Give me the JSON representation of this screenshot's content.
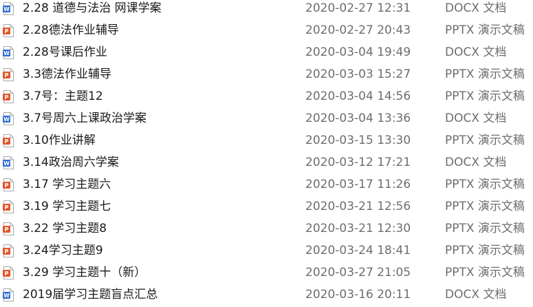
{
  "icon_colors": {
    "docx": "#2b6ad3",
    "pptx": "#e0562a"
  },
  "files": [
    {
      "name": "2.28 道德与法治 网课学案",
      "modified": "2020-02-27 12:31",
      "type": "DOCX 文档",
      "icon": "word-document-icon",
      "icon_letter": "W"
    },
    {
      "name": "2.28德法作业辅导",
      "modified": "2020-02-27 20:43",
      "type": "PPTX 演示文稿",
      "icon": "powerpoint-document-icon",
      "icon_letter": "P"
    },
    {
      "name": "2.28号课后作业",
      "modified": "2020-03-04 19:49",
      "type": "DOCX 文档",
      "icon": "word-document-icon",
      "icon_letter": "W"
    },
    {
      "name": "3.3德法作业辅导",
      "modified": "2020-03-03 15:27",
      "type": "PPTX 演示文稿",
      "icon": "powerpoint-document-icon",
      "icon_letter": "P"
    },
    {
      "name": "3.7号：主题12",
      "modified": "2020-03-04 14:56",
      "type": "PPTX 演示文稿",
      "icon": "powerpoint-document-icon",
      "icon_letter": "P"
    },
    {
      "name": "3.7号周六上课政治学案",
      "modified": "2020-03-04 13:36",
      "type": "DOCX 文档",
      "icon": "word-document-icon",
      "icon_letter": "W"
    },
    {
      "name": "3.10作业讲解",
      "modified": "2020-03-15 13:30",
      "type": "PPTX 演示文稿",
      "icon": "powerpoint-document-icon",
      "icon_letter": "P"
    },
    {
      "name": "3.14政治周六学案",
      "modified": "2020-03-12 17:21",
      "type": "DOCX 文档",
      "icon": "word-document-icon",
      "icon_letter": "W"
    },
    {
      "name": "3.17 学习主题六",
      "modified": "2020-03-17 11:26",
      "type": "PPTX 演示文稿",
      "icon": "powerpoint-document-icon",
      "icon_letter": "P"
    },
    {
      "name": "3.19 学习主题七",
      "modified": "2020-03-21 12:56",
      "type": "PPTX 演示文稿",
      "icon": "powerpoint-document-icon",
      "icon_letter": "P"
    },
    {
      "name": "3.22 学习主题8",
      "modified": "2020-03-21 12:30",
      "type": "PPTX 演示文稿",
      "icon": "powerpoint-document-icon",
      "icon_letter": "P"
    },
    {
      "name": "3.24学习主题9",
      "modified": "2020-03-24 18:41",
      "type": "PPTX 演示文稿",
      "icon": "powerpoint-document-icon",
      "icon_letter": "P"
    },
    {
      "name": "3.29 学习主题十（新）",
      "modified": "2020-03-27 21:05",
      "type": "PPTX 演示文稿",
      "icon": "powerpoint-document-icon",
      "icon_letter": "P"
    },
    {
      "name": "2019届学习主题盲点汇总",
      "modified": "2020-03-16 20:11",
      "type": "DOCX 文档",
      "icon": "word-document-icon",
      "icon_letter": "W"
    }
  ]
}
